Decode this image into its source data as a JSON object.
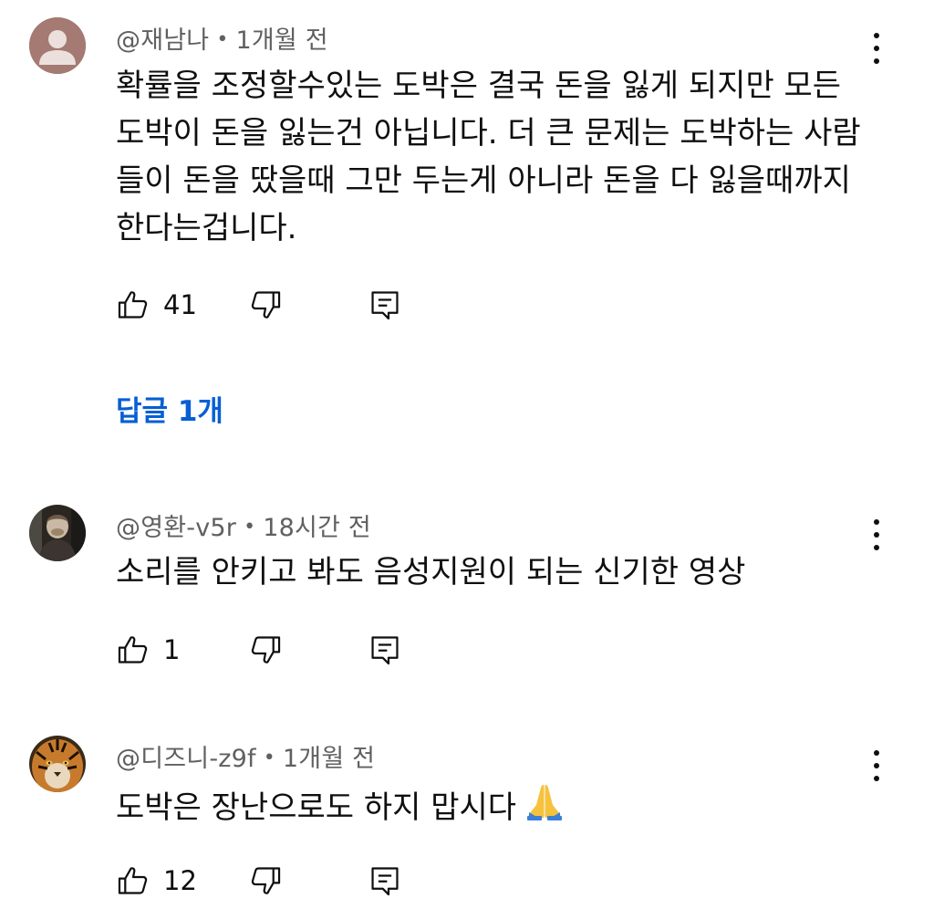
{
  "comments": [
    {
      "author": "@재남나",
      "time": "1개월 전",
      "text": "확률을 조정할수있는 도박은 결국 돈을 잃게 되지만 모든 도박이 돈을 잃는건 아닙니다. 더 큰 문제는 도박하는 사람들이 돈을 땄을때 그만 두는게 아니라 돈을 다 잃을때까지 한다는겁니다.",
      "text_lines": [
        "확률을 조정할수있는 도박은 결국 돈을 잃게 되지만 모든",
        "도박이 돈을 잃는건 아닙니다. 더 큰 문제는 도박하는 사람",
        "들이 돈을 땄을때 그만 두는게 아니라 돈을 다 잃을때까지",
        "한다는겁니다."
      ],
      "likes": "41",
      "replies_label": "답글 1개",
      "avatar": "default-person-icon"
    },
    {
      "author": "@영환-v5r",
      "time": "18시간 전",
      "text_lines": [
        "소리를 안키고 봐도 음성지원이 되는 신기한 영상"
      ],
      "likes": "1",
      "avatar": "photo-avatar-person"
    },
    {
      "author": "@디즈니-z9f",
      "time": "1개월 전",
      "text_lines": [
        "도박은 장난으로도 하지 맙시다"
      ],
      "emoji": "folded-hands-emoji",
      "likes": "12",
      "avatar": "photo-avatar-tiger"
    }
  ],
  "separator": "•",
  "colors": {
    "text": "#0f0f0f",
    "meta": "#606060",
    "link": "#065fd4",
    "default_avatar_bg": "#a47a72"
  },
  "icons": [
    "thumb-up-icon",
    "thumb-down-icon",
    "reply-icon",
    "more-vert-icon"
  ]
}
